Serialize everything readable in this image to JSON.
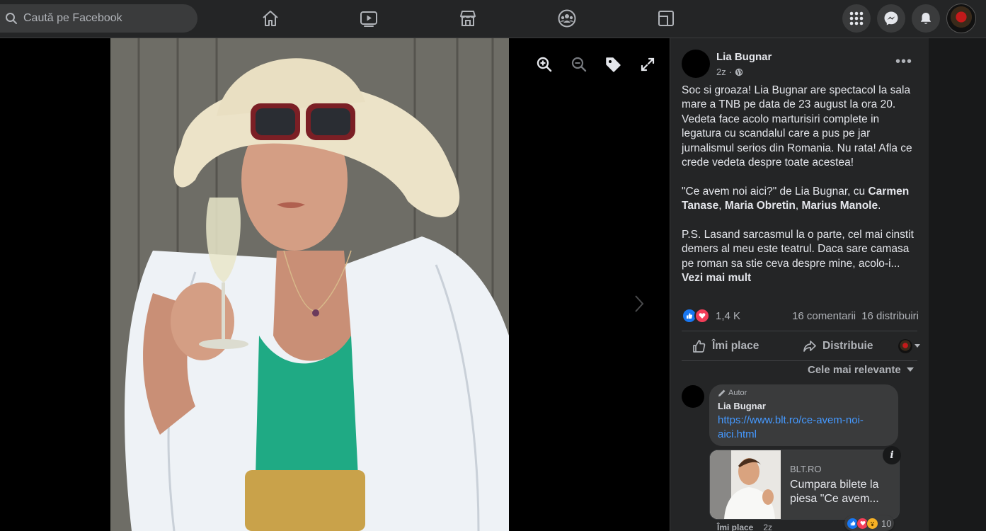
{
  "search": {
    "placeholder": "Caută pe Facebook"
  },
  "nav": {
    "items": [
      "home-icon",
      "watch-icon",
      "marketplace-icon",
      "groups-icon",
      "gaming-icon"
    ]
  },
  "post": {
    "author": "Lia Bugnar",
    "time": "2z",
    "privacy_icon": "globe-icon",
    "paragraph1": "Soc si groaza! Lia Bugnar are spectacol la sala mare a TNB pe data de 23 august la ora 20. Vedeta face acolo marturisiri complete in legatura cu scandalul care a pus pe jar jurnalismul serios din Romania. Nu rata! Afla ce crede vedeta despre toate acestea!",
    "p2_a": "\"Ce avem noi aici?\" de Lia Bugnar, cu ",
    "p2_name1": "Carmen Tanase",
    "p2_sep1": ", ",
    "p2_name2": "Maria Obretin",
    "p2_sep2": ", ",
    "p2_name3": "Marius Manole",
    "p2_end": ".",
    "paragraph3": "P.S. Lasand sarcasmul la o parte, cel mai cinstit demers al meu este teatrul. Daca sare camasa pe roman sa stie ceva despre mine, acolo-i...",
    "see_more": "Vezi mai mult",
    "reaction_count": "1,4 K",
    "comments": "16 comentarii",
    "shares": "16 distribuiri",
    "like_label": "Îmi place",
    "share_label": "Distribuie"
  },
  "comments_section": {
    "sort_label": "Cele mai relevante",
    "comment": {
      "badge": "Autor",
      "author": "Lia Bugnar",
      "link": "https://www.blt.ro/ce-avem-noi-aici.html",
      "card_domain": "BLT.RO",
      "card_title": "Cumpara bilete la piesa \"Ce avem...",
      "reaction_count": "10",
      "like_label": "Îmi place",
      "time": "2z"
    }
  },
  "colors": {
    "accent_link": "#4599ff",
    "like_blue": "#1877f2",
    "love_red": "#f33e58",
    "panel_bg": "#242526"
  }
}
